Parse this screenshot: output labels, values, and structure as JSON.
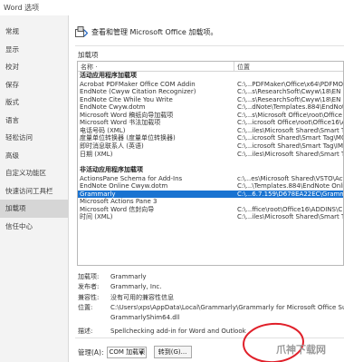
{
  "window": {
    "title": "Word 选项"
  },
  "sidebar": {
    "items": [
      {
        "label": "常规"
      },
      {
        "label": "显示"
      },
      {
        "label": "校对"
      },
      {
        "label": "保存"
      },
      {
        "label": "版式"
      },
      {
        "label": "语言"
      },
      {
        "label": "轻松访问"
      },
      {
        "label": "高级"
      },
      {
        "label": "自定义功能区"
      },
      {
        "label": "快速访问工具栏"
      },
      {
        "label": "加载项"
      },
      {
        "label": "信任中心"
      }
    ],
    "active_index": 10
  },
  "header": {
    "text": "查看和管理 Microsoft Office 加载项。",
    "icon": "addins-icon"
  },
  "addins": {
    "section_title": "加载项",
    "columns": {
      "name": "名称 ·",
      "location": "位置"
    },
    "active_group": {
      "label": "活动应用程序加载项",
      "rows": [
        {
          "name": "Acrobat PDFMaker Office COM Addin",
          "location": "C:\\...PDFMaker\\Office\\x64\\PDFMOff"
        },
        {
          "name": "EndNote (Cwyw Citation Recognizer)",
          "location": "C:\\...s\\ResearchSoft\\Cwyw\\18\\EN"
        },
        {
          "name": "EndNote Cite While You Write",
          "location": "C:\\...s\\ResearchSoft\\Cwyw\\18\\EN"
        },
        {
          "name": "EndNote Cwyw.dotm",
          "location": "C:\\...dNote\\Templates.884\\EndNote"
        },
        {
          "name": "Microsoft Word 稿纸向导加载项",
          "location": "C:\\...s\\Microsoft Office\\root\\Office"
        },
        {
          "name": "Microsoft Word 书法加载项",
          "location": "C:\\...icrosoft Office\\root\\Office16\\A"
        },
        {
          "name": "电话号码 (XML)",
          "location": "C:\\...iles\\Microsoft Shared\\Smart Tag"
        },
        {
          "name": "度量单位转换器 (度量单位转换器)",
          "location": "C:\\...icrosoft Shared\\Smart Tag\\MO"
        },
        {
          "name": "即时消息联系人 (英语)",
          "location": "C:\\...icrosoft Shared\\Smart Tag\\IMC"
        },
        {
          "name": "日期 (XML)",
          "location": "C:\\...iles\\Microsoft Shared\\Smart Tag"
        }
      ]
    },
    "inactive_group": {
      "label": "非活动应用程序加载项",
      "rows": [
        {
          "name": "ActionsPane Schema for Add-Ins",
          "location": "c:\\...es\\Microsoft Shared\\VSTO\\Act"
        },
        {
          "name": "EndNote Online Cwyw.dotm",
          "location": "C:\\...\\Templates.884\\EndNote Onli"
        },
        {
          "name": "Grammarly",
          "location": "C:\\...6.7.159\\D678EA22EC\\Grammarl"
        },
        {
          "name": "Microsoft Actions Pane 3",
          "location": ""
        },
        {
          "name": "Microsoft Word 信封向导",
          "location": "C:\\...ffice\\root\\Office16\\ADDINS\\C"
        },
        {
          "name": "时间 (XML)",
          "location": "C:\\...iles\\Microsoft Shared\\Smart Tag"
        }
      ],
      "selected_index": 2
    }
  },
  "details": {
    "addin": {
      "label": "加载项:",
      "value": "Grammarly"
    },
    "publisher": {
      "label": "发布者:",
      "value": "Grammarly, Inc."
    },
    "compatibility": {
      "label": "兼容性:",
      "value": "没有可用的兼容性信息"
    },
    "location": {
      "label": "位置:",
      "value": "C:\\Users\\xps\\AppData\\Local\\Grammarly\\Grammarly for Microsoft Office Suit",
      "value2": "GrammarlyShim64.dll"
    },
    "description": {
      "label": "描述:",
      "value": "Spellchecking add-in for Word and Outlook"
    }
  },
  "manage": {
    "label": "管理(A):",
    "selected": "COM 加载项",
    "go_label": "转到(G)..."
  },
  "annotation": {
    "color": "#e0202a"
  },
  "watermark": {
    "text": "爪神下载网"
  }
}
